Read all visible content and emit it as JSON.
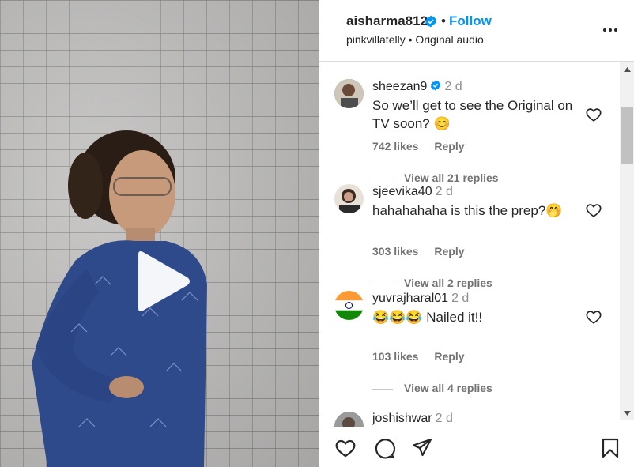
{
  "post": {
    "username": "aisharma812",
    "follow_label": "Follow",
    "dot": "•",
    "audio_account": "pinkvillatelly",
    "audio_sep": "•",
    "audio_label": "Original audio"
  },
  "comments": [
    {
      "user": "sheezan9",
      "verified": true,
      "time": "2 d",
      "text": "So we’ll get to see the Original on TV soon? 😊",
      "likes": "742 likes",
      "reply": "Reply",
      "replies": "View all 21 replies"
    },
    {
      "user": "sjeevika40",
      "verified": false,
      "time": "2 d",
      "text": "hahahahaha is this the prep?🤭",
      "likes": "303 likes",
      "reply": "Reply",
      "replies": "View all 2 replies"
    },
    {
      "user": "yuvrajharal01",
      "verified": false,
      "time": "2 d",
      "text": "😂😂😂 Nailed it!!",
      "likes": "103 likes",
      "reply": "Reply",
      "replies": "View all 4 replies"
    },
    {
      "user": "joshishwar",
      "verified": false,
      "time": "2 d"
    }
  ],
  "icons": {
    "more": "more-options-icon",
    "verified": "verified-badge-icon",
    "heart": "heart-icon",
    "comment": "comment-icon",
    "share": "share-icon",
    "save": "bookmark-icon",
    "play": "play-icon"
  },
  "colors": {
    "accent": "#0095f6",
    "text": "#262626",
    "muted": "#737373",
    "verified": "#0095f6"
  }
}
